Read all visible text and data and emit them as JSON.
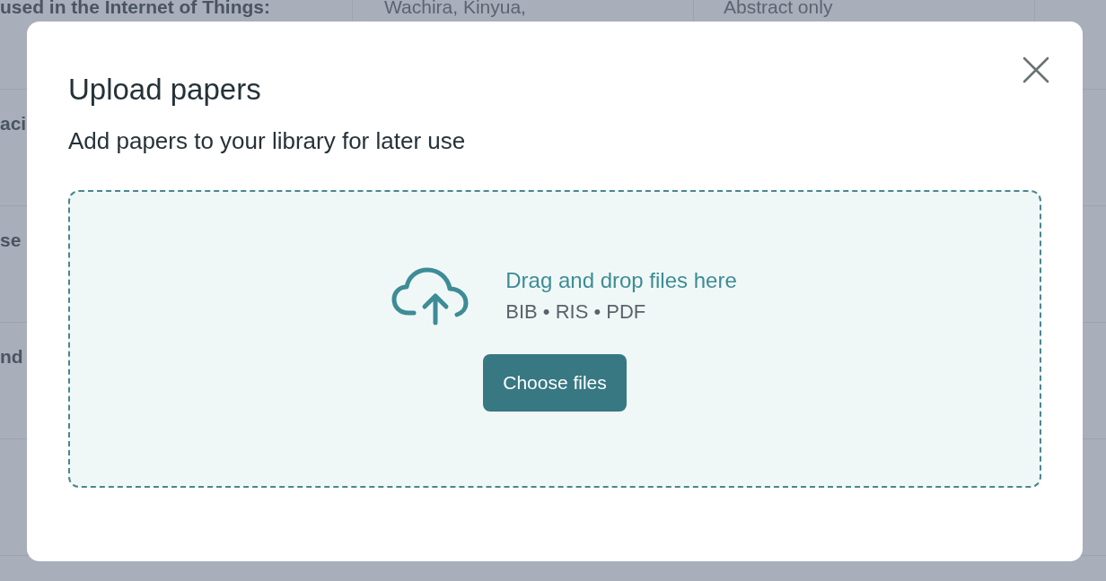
{
  "background_table": {
    "rows": [
      {
        "cells": [
          "used in the Internet of Things:",
          "Wachira, Kinyua,",
          "Abstract only"
        ]
      },
      {
        "cells": [
          "aci",
          "",
          ""
        ]
      },
      {
        "cells": [
          "se",
          "",
          ""
        ]
      },
      {
        "cells": [
          "nd",
          "",
          ""
        ]
      },
      {
        "cells": [
          "",
          "",
          ""
        ]
      }
    ]
  },
  "modal": {
    "title": "Upload papers",
    "subtitle": "Add papers to your library for later use",
    "dropzone": {
      "heading": "Drag and drop files here",
      "formats": "BIB • RIS • PDF",
      "button": "Choose files"
    }
  }
}
